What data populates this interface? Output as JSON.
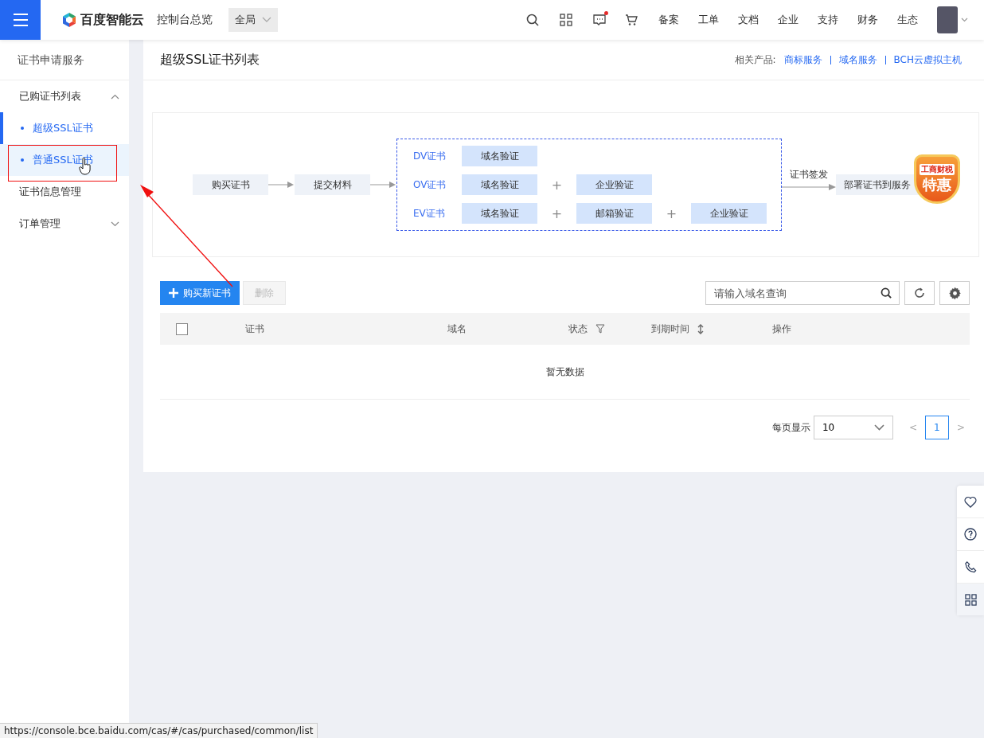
{
  "topbar": {
    "brand": "百度智能云",
    "console": "控制台总览",
    "region": "全局",
    "message_unread": true,
    "nav": [
      "备案",
      "工单",
      "文档",
      "企业",
      "支持",
      "财务",
      "生态"
    ]
  },
  "sidebar": {
    "title": "证书申请服务",
    "items": [
      {
        "kind": "group",
        "label": "已购证书列表",
        "expanded": true,
        "children": [
          {
            "label": "超级SSL证书",
            "selected": true,
            "hovered": false
          },
          {
            "label": "普通SSL证书",
            "selected": false,
            "hovered": true
          }
        ]
      },
      {
        "kind": "link",
        "label": "证书信息管理"
      },
      {
        "kind": "group",
        "label": "订单管理",
        "expanded": false
      }
    ]
  },
  "page": {
    "title": "超级SSL证书列表",
    "related_label": "相关产品:",
    "related": [
      "商标服务",
      "域名服务",
      "BCH云虚拟主机"
    ]
  },
  "flow": {
    "steps": [
      "购买证书",
      "提交材料"
    ],
    "rows": [
      {
        "type": "DV证书",
        "checks": [
          "域名验证"
        ]
      },
      {
        "type": "OV证书",
        "checks": [
          "域名验证",
          "企业验证"
        ]
      },
      {
        "type": "EV证书",
        "checks": [
          "域名验证",
          "邮箱验证",
          "企业验证"
        ]
      }
    ],
    "plus": "+",
    "issue_label": "证书签发",
    "deploy": "部署证书到服务",
    "badge": {
      "top": "工商财税",
      "main": "特惠"
    }
  },
  "toolbar": {
    "buttons": [
      {
        "kind": "primary",
        "label": "购买新证书",
        "disabled": false
      },
      {
        "kind": "default",
        "label": "删除",
        "disabled": true
      }
    ],
    "search": {
      "placeholder": "请输入域名查询"
    }
  },
  "table": {
    "select_all_checked": false,
    "columns": [
      {
        "label": "证书",
        "kind": "plain"
      },
      {
        "label": "域名",
        "kind": "plain"
      },
      {
        "label": "状态",
        "kind": "filter"
      },
      {
        "label": "到期时间",
        "kind": "sort"
      },
      {
        "label": "操作",
        "kind": "plain"
      }
    ],
    "empty": "暂无数据"
  },
  "pagination": {
    "per_page_label": "每页显示",
    "page_size": "10",
    "prev": "<",
    "next": ">",
    "pages": [
      {
        "label": "1",
        "selected": true
      }
    ]
  },
  "status_url": "https://console.bce.baidu.com/cas/#/cas/purchased/common/list"
}
